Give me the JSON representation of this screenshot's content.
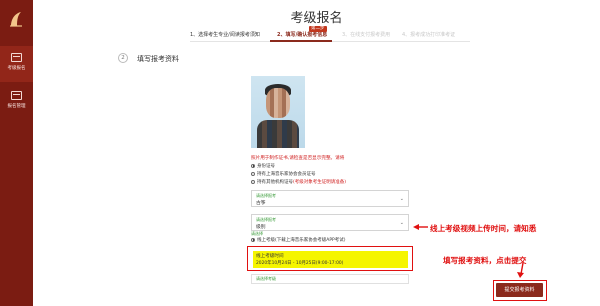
{
  "sidebar": {
    "items": [
      {
        "label": "考级报名",
        "icon": "registration-icon"
      },
      {
        "label": "报名管理",
        "icon": "manage-icon"
      }
    ]
  },
  "header": {
    "title": "考级报名"
  },
  "steps": {
    "items": [
      "1、选择考生专业/阅读报考须知",
      "2、填写/确认报考信息",
      "3、在线支付报考费用",
      "4、报考成功打印准考证"
    ],
    "current_badge": "第二步"
  },
  "section": {
    "number": "2",
    "title": "填写报考资料"
  },
  "form": {
    "photo_note": "照片用于制作证书,请检查是否显示完整。请将",
    "id_options": [
      "身份证号",
      "持有上海音乐家协会会员证号",
      "持有其他机构证号"
    ],
    "id_options_extra": "(考级对象考生证明请准备)",
    "field1": {
      "label": "请选择报考",
      "value": "古筝"
    },
    "field2": {
      "label": "请选择报考",
      "value": "级别"
    },
    "exam_mode_label": "请选择",
    "exam_mode_option": "线上考级(下载上海音乐家协会考级APP考试)",
    "highlight": {
      "line1": "线上考级时间",
      "line2": "2020年10月24日 - 10月25日(9:00-17:00)"
    },
    "extra_label": "请选择考级"
  },
  "annotations": {
    "note1": "线上考级视频上传时间，请知悉",
    "note2": "填写报考资料，点击提交"
  },
  "submit": {
    "label": "提交报考资料"
  },
  "colors": {
    "sidebar": "#7b1c12",
    "accent": "#8b2a1d",
    "annotation": "#e01010",
    "highlight": "#f5f500"
  }
}
